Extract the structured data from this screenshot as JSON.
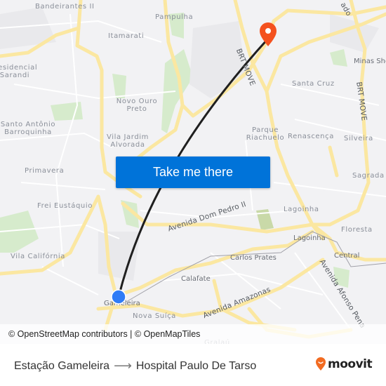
{
  "map": {
    "neighborhood_labels": [
      {
        "text": "Bandeirantes II"
      },
      {
        "text": "Pampulha"
      },
      {
        "text": "Itamarati"
      },
      {
        "text": "Residencial Sarandi"
      },
      {
        "text": "Novo Ouro Preto"
      },
      {
        "text": "Santa Cruz"
      },
      {
        "text": "Santo Antônio Barroquinha"
      },
      {
        "text": "Vila Jardim Alvorada"
      },
      {
        "text": "Parque Riachuelo"
      },
      {
        "text": "Renascença"
      },
      {
        "text": "Silveira"
      },
      {
        "text": "Primavera"
      },
      {
        "text": "Sagrada"
      },
      {
        "text": "Frei Eustáquio"
      },
      {
        "text": "Lagoinha"
      },
      {
        "text": "Floresta"
      },
      {
        "text": "Vila Califórnia"
      },
      {
        "text": "Nova Suíça"
      },
      {
        "text": "Gralaú"
      }
    ],
    "poi_labels": [
      {
        "text": "Minas Shop"
      },
      {
        "text": "Lagoinha"
      },
      {
        "text": "Carlos Prates"
      },
      {
        "text": "Central"
      },
      {
        "text": "Calafate"
      },
      {
        "text": "Gameleira"
      }
    ],
    "street_labels": [
      {
        "text": "BRT MOVE"
      },
      {
        "text": "BRT MOVE"
      },
      {
        "text": "Avenida Dom Pedro II"
      },
      {
        "text": "Avenida Amazonas"
      },
      {
        "text": "Avenida Afonso Pena"
      },
      {
        "text": "ado"
      }
    ],
    "colors": {
      "background": "#f2f2f4",
      "major_road": "#fbe7a1",
      "park": "#cfe6c2",
      "route_line": "#1f1f1f",
      "origin_marker": "#2f7cf6",
      "destination_marker": "#f4511e"
    },
    "origin_marker": {
      "icon": "origin-dot-icon"
    },
    "destination_marker": {
      "icon": "destination-pin-icon"
    }
  },
  "cta": {
    "label": "Take me there",
    "color": "#0073d9"
  },
  "attribution": {
    "text": "© OpenStreetMap contributors | © OpenMapTiles"
  },
  "footer": {
    "origin": "Estação Gameleira",
    "arrow_icon": "arrow-right-icon",
    "destination": "Hospital Paulo De Tarso",
    "brand": {
      "name": "moovit",
      "icon": "moovit-pin-icon",
      "color": "#f26b21"
    }
  }
}
